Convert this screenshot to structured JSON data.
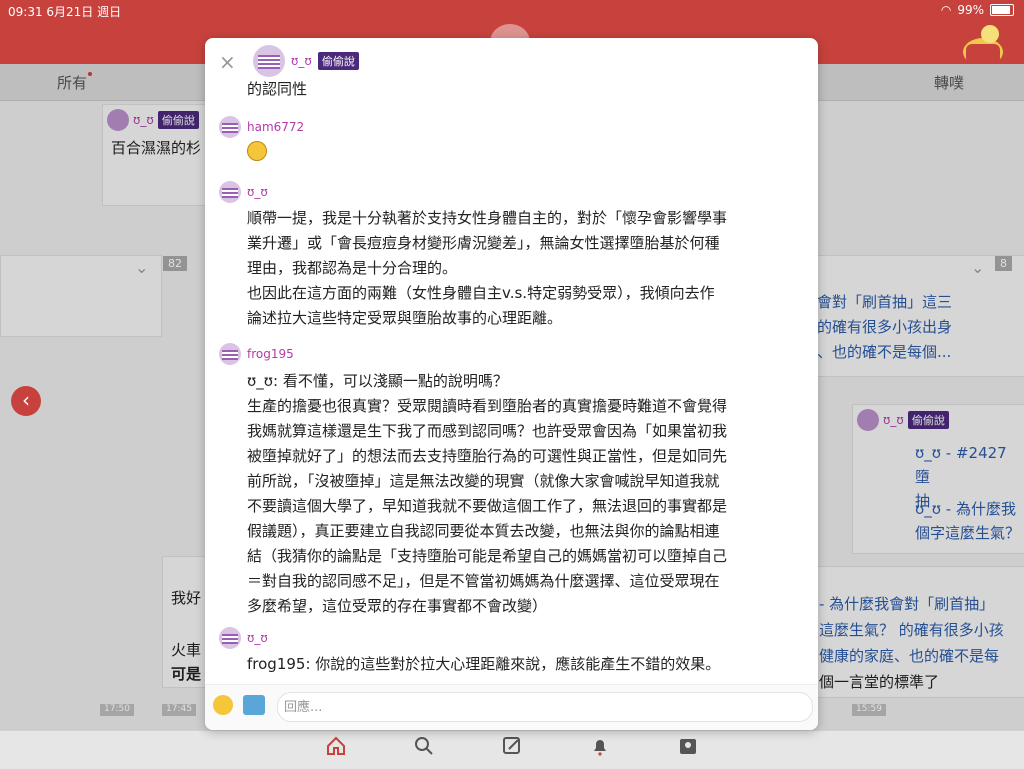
{
  "status": {
    "time": "09:31 6月21日 週日",
    "battery": "99%"
  },
  "tabs": {
    "all": "所有",
    "retweet": "轉噗"
  },
  "background": {
    "card1_user": "ʊ_ʊ",
    "card1_badge": "偷偷說",
    "card1_text": "百合濕濕的杉",
    "counter1": "82",
    "counter2": "8",
    "right_card_text1": "會對「刷首抽」這三",
    "right_card_text2": "的確有很多小孩出身",
    "right_card_text3": "、也的確不是每個...",
    "right_user": "ʊ_ʊ",
    "right_badge": "偷偷說",
    "link1": "ʊ_ʊ - #2427 墮",
    "link1b": "抽",
    "link2": "ʊ_ʊ - 為什麼我",
    "link2b": "個字這麼生氣？",
    "left_text1": "我好",
    "left_text2": "火車",
    "left_text3": "可是",
    "right_lower1": "- 為什麼我會對「刷首抽」",
    "right_lower2": "這麼生氣？ 的確有很多小孩",
    "right_lower3": "健康的家庭、也的確不是每",
    "right_lower4": "個一言堂的標準了",
    "times": [
      "17:50",
      "17:45",
      "15:59"
    ]
  },
  "modal": {
    "header_user": "ʊ_ʊ",
    "header_badge": "偷偷說",
    "intro_text": "的認同性",
    "entries": [
      {
        "user": "ham6772",
        "lines": []
      },
      {
        "user": "ʊ_ʊ",
        "lines": [
          "順帶一提，我是十分執著於支持女性身體自主的，對於「懷孕會影響學事",
          "業升遷」或「會長痘痘身材變形膚況變差」，無論女性選擇墮胎基於何種",
          "理由，我都認為是十分合理的。",
          "也因此在這方面的兩難（女性身體自主v.s.特定弱勢受眾），我傾向去作",
          "論述拉大這些特定受眾與墮胎故事的心理距離。"
        ]
      },
      {
        "user": "frog195",
        "lines": [
          "ʊ_ʊ: 看不懂，可以淺顯一點的說明嗎？",
          "生產的擔憂也很真實？受眾閱讀時看到墮胎者的真實擔憂時難道不會覺得",
          "我媽就算這樣還是生下我了而感到認同嗎？也許受眾會因為「如果當初我",
          "被墮掉就好了」的想法而去支持墮胎行為的可選性與正當性，但是如同先",
          "前所說，「沒被墮掉」這是無法改變的現實（就像大家會喊說早知道我就",
          "不要讀這個大學了，早知道我就不要做這個工作了，無法退回的事實都是",
          "假議題），真正要建立自我認同要從本質去改變，也無法與你的論點相連",
          "結（我猜你的論點是「支持墮胎可能是希望自己的媽媽當初可以墮掉自己",
          "＝對自我的認同感不足」，但是不管當初媽媽為什麼選擇、這位受眾現在",
          "多麼希望，這位受眾的存在事實都不會改變）"
        ]
      },
      {
        "user": "ʊ_ʊ",
        "lines": [
          "frog195: 你說的這些對於拉大心理距離來說，應該能產生不錯的效果。"
        ]
      }
    ],
    "reply_placeholder": "回應..."
  },
  "colors": {
    "brand": "#c8423d",
    "badge": "#4b2a7b",
    "username": "#b33ba8",
    "link": "#2b5aa8"
  },
  "icons": [
    "home-icon",
    "search-icon",
    "compose-icon",
    "bell-icon",
    "profile-card-icon",
    "close-icon",
    "back-icon",
    "emoji-icon",
    "image-icon",
    "wifi-icon",
    "battery-icon"
  ]
}
